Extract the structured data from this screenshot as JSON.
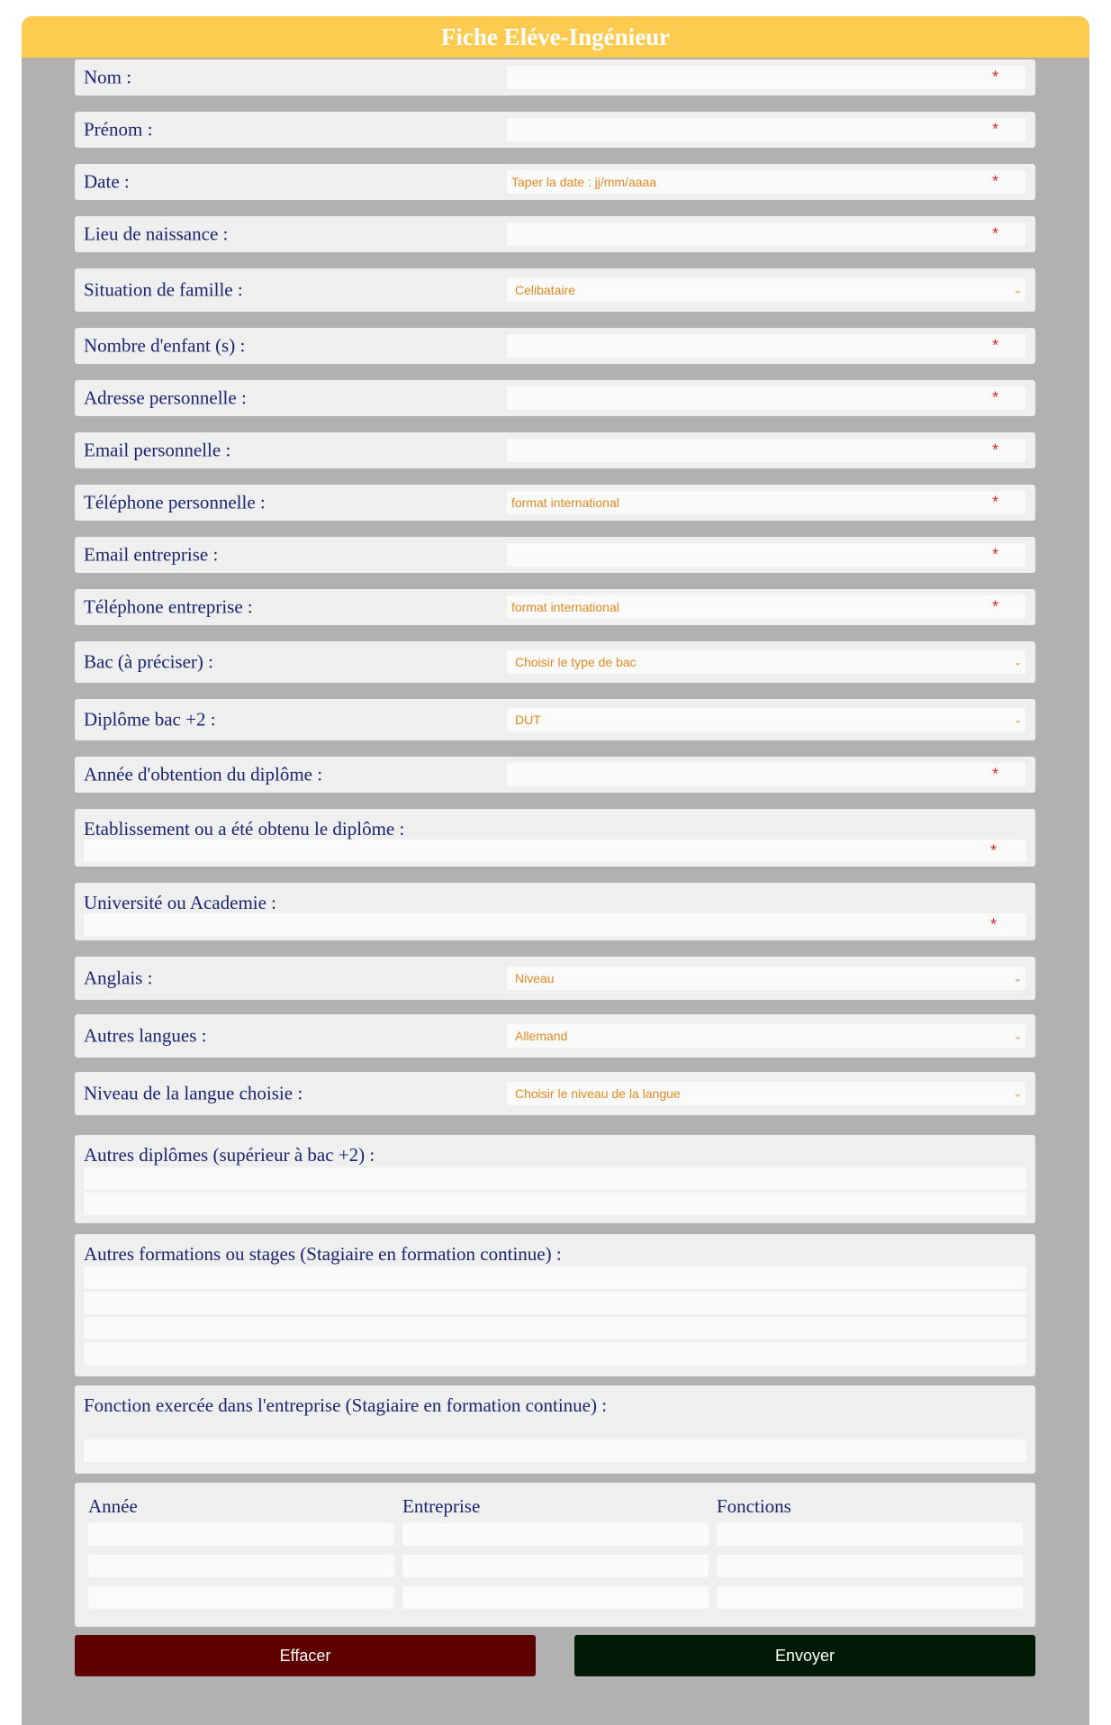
{
  "title": "Fiche Eléve-Ingénieur",
  "fields": {
    "nom": {
      "label": "Nom :",
      "required": "*"
    },
    "prenom": {
      "label": "Prénom :",
      "required": "*"
    },
    "date": {
      "label": "Date :",
      "placeholder": "Taper la date : jj/mm/aaaa",
      "required": "*"
    },
    "lieu": {
      "label": "Lieu de naissance :",
      "required": "*"
    },
    "situation": {
      "label": "Situation de famille :",
      "value": "Celibataire"
    },
    "enfants": {
      "label": "Nombre d'enfant (s) :",
      "required": "*"
    },
    "adresse": {
      "label": "Adresse personnelle :",
      "required": "*"
    },
    "email_perso": {
      "label": "Email personnelle :",
      "required": "*"
    },
    "tel_perso": {
      "label": "Téléphone personnelle :",
      "placeholder": "format international",
      "required": "*"
    },
    "email_ent": {
      "label": "Email entreprise :",
      "required": "*"
    },
    "tel_ent": {
      "label": "Téléphone entreprise :",
      "placeholder": "format international",
      "required": "*"
    },
    "bac": {
      "label": "Bac (à préciser) :",
      "value": "Choisir le type de bac"
    },
    "diplome": {
      "label": "Diplôme bac +2 :",
      "value": "DUT"
    },
    "annee": {
      "label": "Année d'obtention du diplôme :",
      "required": "*"
    },
    "etablissement": {
      "label": "Etablissement ou a été obtenu le diplôme :",
      "required": "*"
    },
    "universite": {
      "label": "Université ou Academie :",
      "required": "*"
    },
    "anglais": {
      "label": "Anglais :",
      "value": "Niveau"
    },
    "autres_langues": {
      "label": "Autres langues :",
      "value": "Allemand"
    },
    "niveau_langue": {
      "label": "Niveau de la langue choisie :",
      "value": "Choisir le niveau de la langue"
    },
    "autres_diplomes": {
      "label": "Autres diplômes (supérieur à bac +2) :"
    },
    "autres_formations": {
      "label": "Autres formations ou stages (Stagiaire en formation continue) :"
    },
    "fonction": {
      "label": "Fonction exercée dans l'entreprise (Stagiaire en formation continue) :"
    }
  },
  "experience_table": {
    "headers": [
      "Année",
      "Entreprise",
      "Fonctions"
    ]
  },
  "buttons": {
    "reset": "Effacer",
    "submit": "Envoyer"
  },
  "colors": {
    "header": "#fccb50",
    "reset": "#5e0000",
    "submit": "#001a05",
    "label": "#1c2470",
    "placeholder": "#e38a1f",
    "required": "#e32b2b"
  }
}
